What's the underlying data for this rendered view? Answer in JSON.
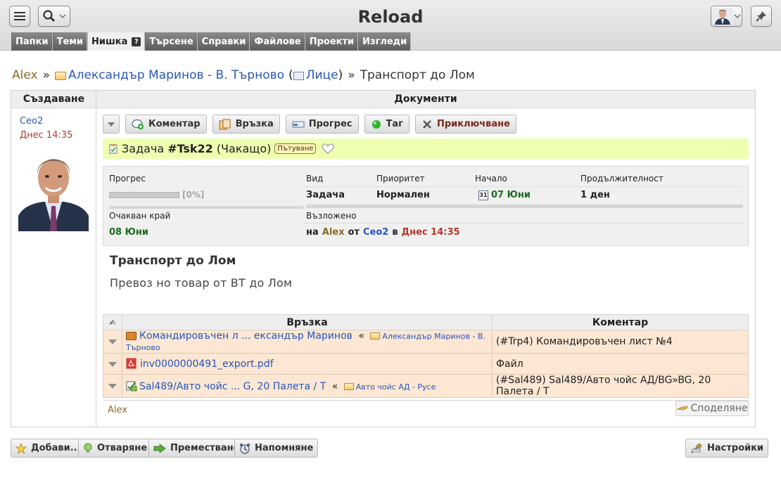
{
  "app": {
    "title": "Reload"
  },
  "tabs": [
    {
      "label": "Папки"
    },
    {
      "label": "Теми"
    },
    {
      "label": "Нишка",
      "help": "?"
    },
    {
      "label": "Търсене"
    },
    {
      "label": "Справки"
    },
    {
      "label": "Файлове"
    },
    {
      "label": "Проекти"
    },
    {
      "label": "Изгледи"
    }
  ],
  "breadcrumb": {
    "user": "Alex",
    "sep": "»",
    "folder": "Александър Маринов - В. Търново",
    "open_paren": "(",
    "type_link": "Лице",
    "close_paren": ")",
    "sep2": "»",
    "current": "Транспорт до Лом"
  },
  "columns": {
    "left": "Създаване",
    "right": "Документи"
  },
  "creator": {
    "name": "Ceo2",
    "time": "Днес 14:35"
  },
  "toolbar": {
    "comment": "Коментар",
    "relation": "Връзка",
    "progress": "Прогрес",
    "tag": "Таг",
    "finish": "Приключване"
  },
  "task": {
    "type": "Задача",
    "id": "#Tsk22",
    "status": "(Чакащо)",
    "tag": "Пътуване"
  },
  "info": {
    "labels": {
      "progress": "Прогрес",
      "kind": "Вид",
      "priority": "Приоритет",
      "start": "Начало",
      "duration": "Продължителност",
      "expected_end": "Очакван край",
      "assigned": "Възложено"
    },
    "progress_value": 0,
    "progress_text": "[0%]",
    "kind": "Задача",
    "priority": "Нормален",
    "cal_day": "31",
    "start": "07 Юни",
    "duration": "1 ден",
    "expected_end": "08 Юни",
    "assigned": {
      "on": "на",
      "to_user": "Alex",
      "from": "от",
      "by_user": "Ceo2",
      "at": "в",
      "time": "Днес 14:35"
    }
  },
  "description": {
    "title": "Транспорт до Лом",
    "body": "Превоз но товар от ВТ до Лом"
  },
  "relations": {
    "headers": {
      "icon": "✍",
      "link": "Връзка",
      "comment": "Коментар"
    },
    "rows": [
      {
        "icon": "briefcase-icon",
        "link": "Командировъчен л ... ександър Маринов",
        "guillemet": "«",
        "folder": "Александър Маринов - В. Търново",
        "comment": "(#Trp4) Командировъчен лист №4"
      },
      {
        "icon": "pdf-icon",
        "link": "inv0000000491_export.pdf",
        "guillemet": "",
        "folder": "",
        "comment": "Файл"
      },
      {
        "icon": "sale-icon",
        "link": "Sal489/Авто чойс ... G, 20 Палета / Т",
        "guillemet": "«",
        "folder": "Авто чойс АД - Русе",
        "comment": "(#Sal489) Sal489/Авто чойс АД/BG»BG, 20 Палета / Т"
      }
    ]
  },
  "footer": {
    "user": "Alex",
    "share": "Споделяне"
  },
  "bottom": {
    "add": "Добави...",
    "open": "Отваряне",
    "move": "Преместване",
    "remind": "Напомняне",
    "settings": "Настройки"
  },
  "colors": {
    "task_bar": "#eeffb0",
    "row_bg": "#fbe7d3",
    "link": "#2a56b8",
    "user": "#8a6a2c",
    "date_green": "#1c6b1c",
    "time_red": "#b03a2e"
  }
}
